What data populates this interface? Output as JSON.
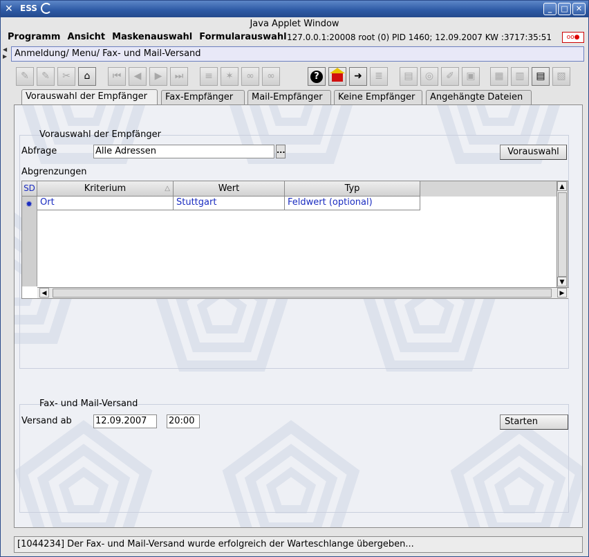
{
  "window": {
    "app_name": "ESS",
    "icon": "x-tools-icon",
    "controls": {
      "minimize": "_",
      "maximize": "□",
      "close": "✕"
    }
  },
  "applet_title": "Java Applet Window",
  "menu": {
    "items": [
      "Programm",
      "Ansicht",
      "Maskenauswahl",
      "Formularauswahl"
    ],
    "status": "127.0.0.1:20008 root (0) PID 1460; 12.09.2007 KW :3717:35:51",
    "indicator": "oo●"
  },
  "breadcrumb": "Anmeldung/ Menu/ Fax- und Mail-Versand",
  "toolbar": {
    "buttons": [
      {
        "icon": "save-icon",
        "glyph": "✎",
        "active": false
      },
      {
        "icon": "edit-icon",
        "glyph": "✎",
        "active": false
      },
      {
        "icon": "delete-icon",
        "glyph": "✂",
        "active": false
      },
      {
        "icon": "clear-icon",
        "glyph": "⌂",
        "active": true
      },
      {
        "icon": "first-record-icon",
        "glyph": "⏮",
        "active": false
      },
      {
        "icon": "previous-record-icon",
        "glyph": "◀",
        "active": false
      },
      {
        "icon": "next-record-icon",
        "glyph": "▶",
        "active": false
      },
      {
        "icon": "last-record-icon",
        "glyph": "⏭",
        "active": false
      },
      {
        "icon": "filter-icon",
        "glyph": "≡",
        "active": false
      },
      {
        "icon": "filter-clear-icon",
        "glyph": "✶",
        "active": false
      },
      {
        "icon": "search-icon",
        "glyph": "∞",
        "active": false
      },
      {
        "icon": "search-next-icon",
        "glyph": "∞",
        "active": false
      },
      {
        "icon": "help-icon",
        "glyph": "?",
        "active": true
      },
      {
        "icon": "home-icon",
        "glyph": "⌂",
        "active": true
      },
      {
        "icon": "exit-icon",
        "glyph": "➜",
        "active": true
      },
      {
        "icon": "list-icon",
        "glyph": "≣",
        "active": false
      },
      {
        "icon": "print-icon",
        "glyph": "▤",
        "active": false
      },
      {
        "icon": "preview-icon",
        "glyph": "◎",
        "active": false
      },
      {
        "icon": "tools-icon",
        "glyph": "✐",
        "active": false
      },
      {
        "icon": "document-icon",
        "glyph": "▣",
        "active": false
      },
      {
        "icon": "table-icon",
        "glyph": "▦",
        "active": false
      },
      {
        "icon": "form-icon",
        "glyph": "▥",
        "active": false
      },
      {
        "icon": "grid-icon",
        "glyph": "▤",
        "active": true
      },
      {
        "icon": "notes-icon",
        "glyph": "▧",
        "active": false
      }
    ]
  },
  "tabs": [
    {
      "label": "Vorauswahl der Empfänger",
      "selected": true
    },
    {
      "label": "Fax-Empfänger",
      "selected": false
    },
    {
      "label": "Mail-Empfänger",
      "selected": false
    },
    {
      "label": "Keine Empfänger",
      "selected": false
    },
    {
      "label": "Angehängte Dateien",
      "selected": false
    }
  ],
  "preselection": {
    "legend": "Vorauswahl der Empfänger",
    "query_label": "Abfrage",
    "query_value": "Alle Adressen",
    "browse_label": "...",
    "button_label": "Vorauswahl",
    "limits_label": "Abgrenzungen",
    "table": {
      "columns": [
        "SD",
        "Kriterium",
        "Wert",
        "Typ"
      ],
      "rows": [
        {
          "kriterium": "Ort",
          "wert": "Stuttgart",
          "typ": "Feldwert (optional)"
        }
      ],
      "row_indicator": "✹"
    }
  },
  "dispatch": {
    "legend": "Fax- und Mail-Versand",
    "send_from_label": "Versand ab",
    "date": "12.09.2007",
    "time": "20:00",
    "start_label": "Starten"
  },
  "status_message": "[1044234] Der Fax- und Mail-Versand wurde erfolgreich der Warteschlange übergeben..."
}
